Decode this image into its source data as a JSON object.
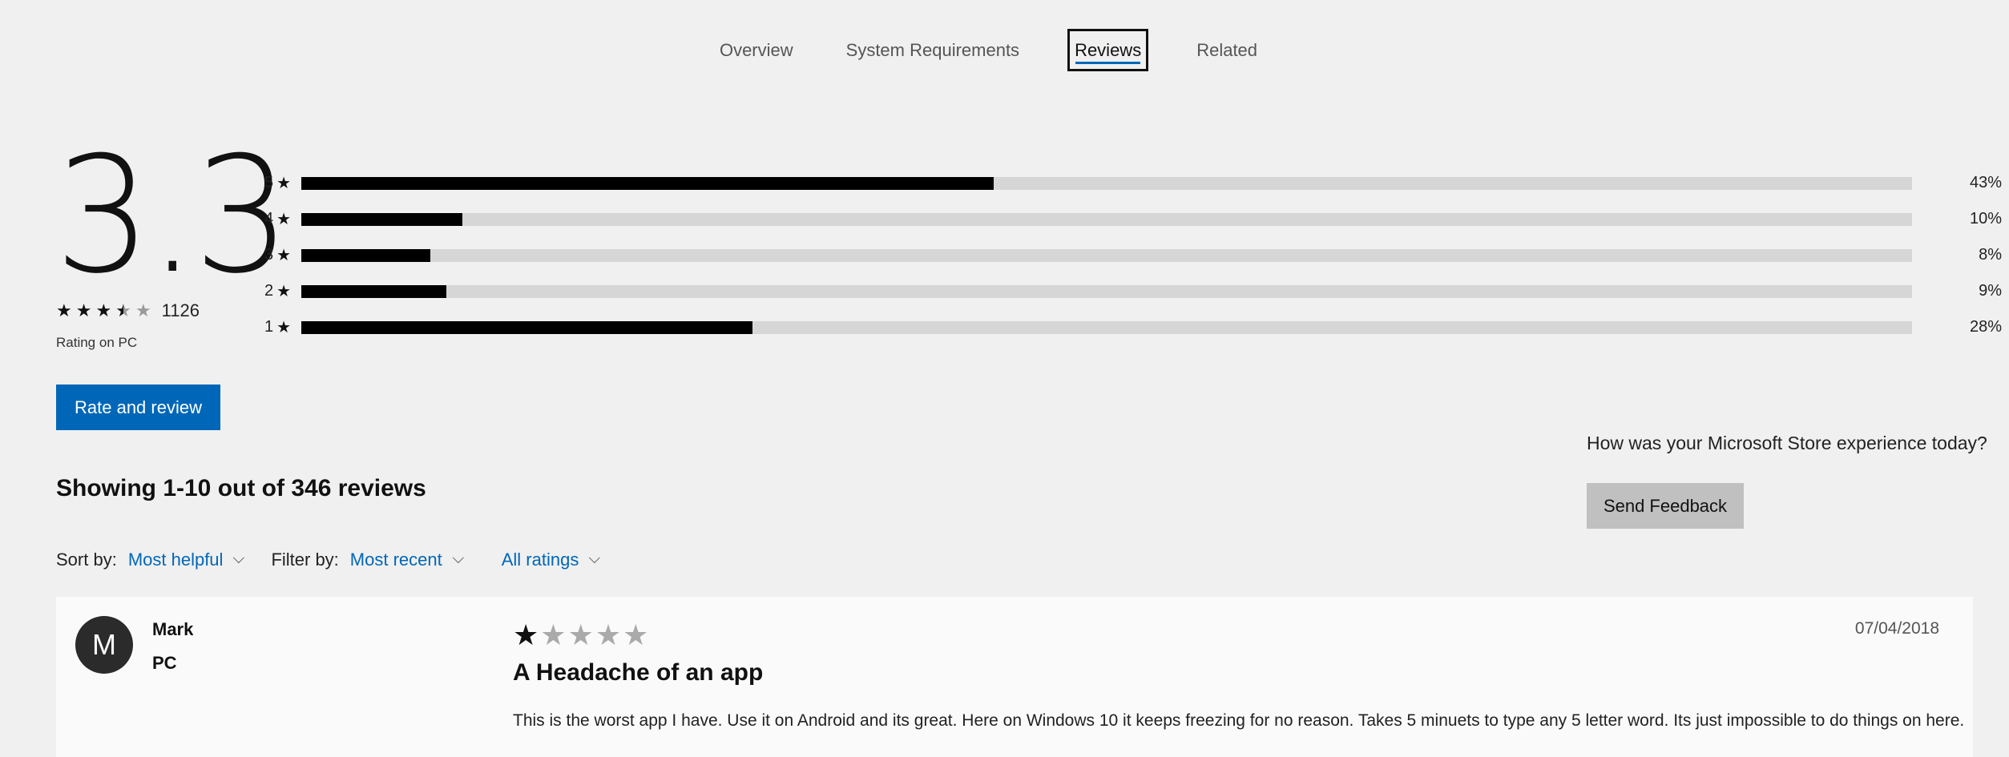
{
  "tabs": [
    {
      "label": "Overview"
    },
    {
      "label": "System Requirements"
    },
    {
      "label": "Reviews",
      "active": true
    },
    {
      "label": "Related"
    }
  ],
  "summary": {
    "score": "3.3",
    "stars_value": 3.3,
    "count": "1126",
    "rating_on": "Rating on PC"
  },
  "histogram": [
    {
      "stars": "5",
      "percent": 43,
      "label": "43%"
    },
    {
      "stars": "4",
      "percent": 10,
      "label": "10%"
    },
    {
      "stars": "3",
      "percent": 8,
      "label": "8%"
    },
    {
      "stars": "2",
      "percent": 9,
      "label": "9%"
    },
    {
      "stars": "1",
      "percent": 28,
      "label": "28%"
    }
  ],
  "rate_button": "Rate and review",
  "feedback": {
    "question": "How was your Microsoft Store experience today?",
    "button": "Send Feedback"
  },
  "showing": "Showing 1-10 out of 346 reviews",
  "controls": {
    "sort_label": "Sort by:",
    "sort_value": "Most helpful",
    "filter_label": "Filter by:",
    "filter_value": "Most recent",
    "ratings_value": "All ratings"
  },
  "review": {
    "avatar_letter": "M",
    "name": "Mark",
    "device": "PC",
    "stars": 1,
    "title": "A Headache of an app",
    "body": "This is the worst app I have. Use it on Android and its great. Here on Windows 10 it keeps freezing for no reason. Takes 5 minuets to type any 5 letter word. Its just impossible to do things on here.",
    "date": "07/04/2018"
  },
  "colors": {
    "accent": "#0067b8",
    "background": "#f0f0f0",
    "card": "#fafafa"
  }
}
